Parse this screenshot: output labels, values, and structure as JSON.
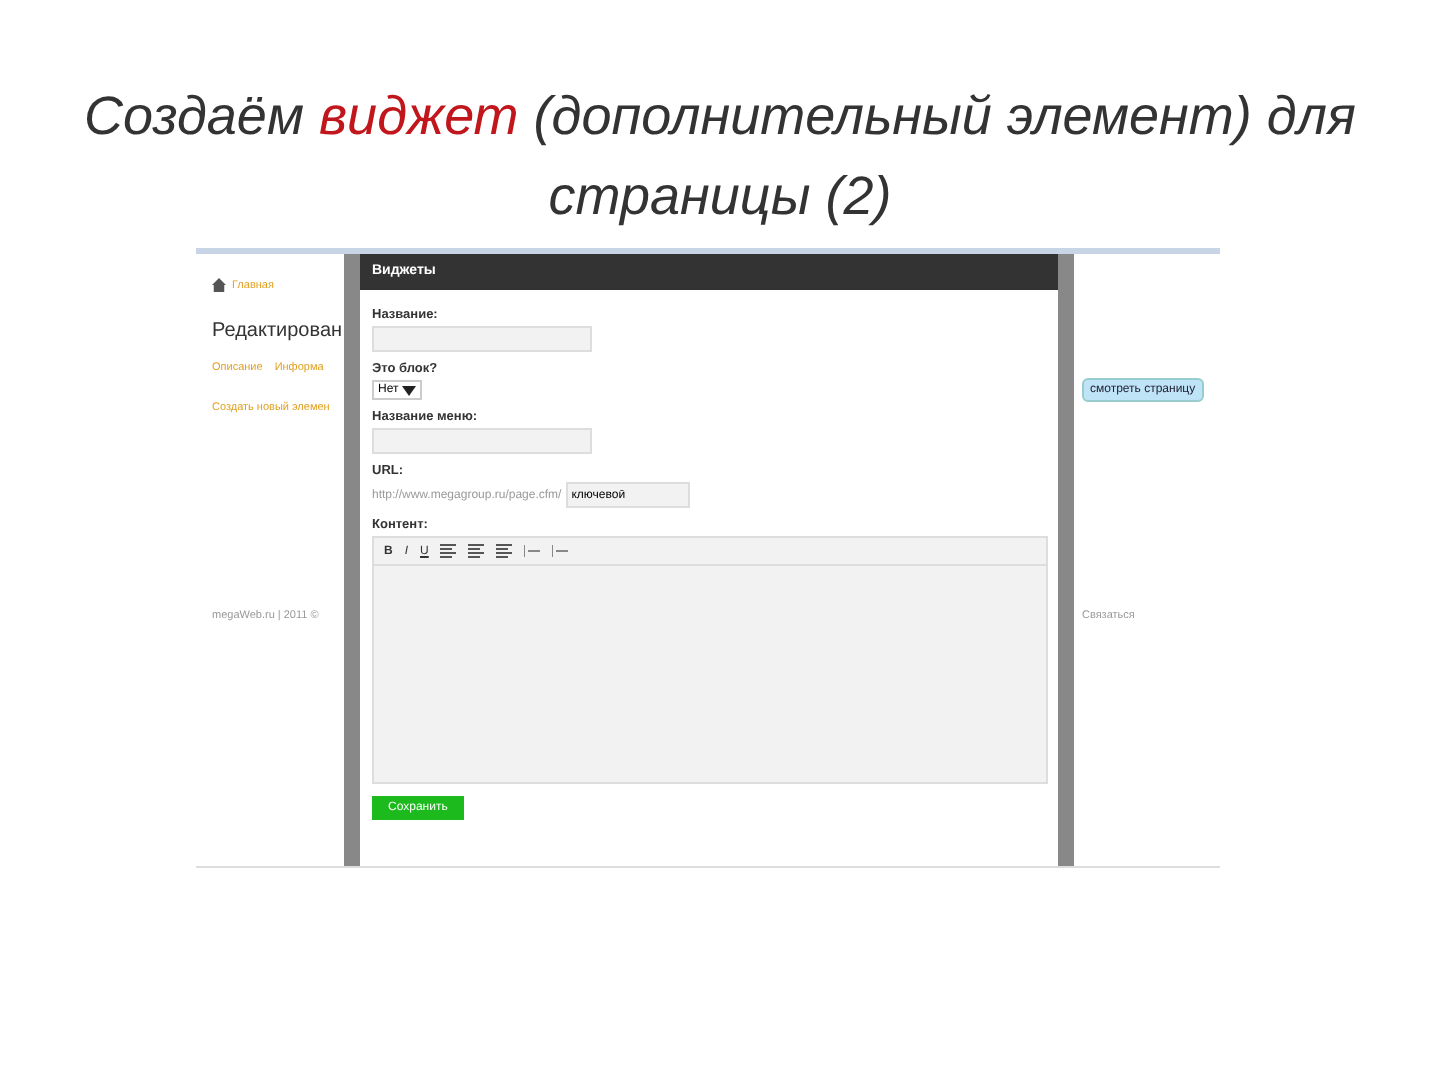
{
  "slide_title": {
    "before": "Создаём ",
    "highlight": "виджет",
    "after": " (дополнительный элемент) для страницы (2)"
  },
  "page": {
    "breadcrumb": "Главная",
    "heading": "Редактирован",
    "tabs": [
      "Описание",
      "Информа"
    ],
    "create_link": "Создать новый элемен",
    "view_button": "смотреть страницу",
    "footer_left": "megaWeb.ru | 2011 ©",
    "footer_right": "Связаться"
  },
  "dialog": {
    "title": "Виджеты",
    "fields": [
      {
        "kind": "text",
        "label": "Название:"
      },
      {
        "kind": "select",
        "label": "Это блок?",
        "value": "Нет"
      },
      {
        "kind": "text",
        "label": "Название меню:"
      },
      {
        "kind": "url",
        "label": "URL:",
        "prefix": "http://www.megagroup.ru/page.cfm/",
        "value": "ключевой"
      },
      {
        "kind": "editor",
        "label": "Контент:",
        "tools": [
          "B",
          "I",
          "U"
        ]
      }
    ],
    "save_button": "Сохранить"
  }
}
